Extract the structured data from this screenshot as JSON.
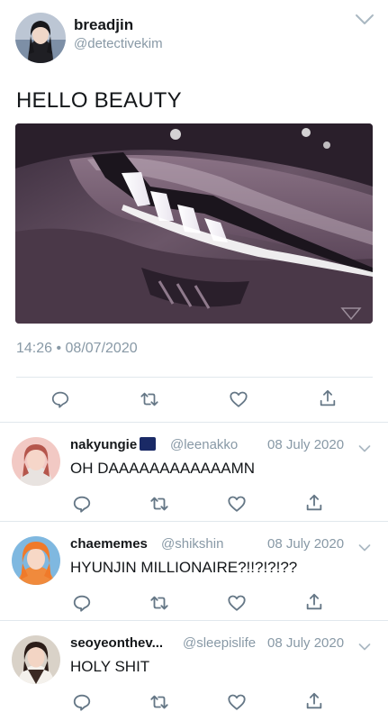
{
  "tweet": {
    "display_name": "breadjin",
    "handle": "@detectivekim",
    "text": "HELLO BEAUTY",
    "timestamp": "14:26 • 08/07/2020",
    "avatar_icon": "avatar-photo",
    "media_description_icon": "car-headlight-photo"
  },
  "actions": {
    "reply_icon": "reply-icon",
    "retweet_icon": "retweet-icon",
    "like_icon": "heart-icon",
    "share_icon": "share-icon"
  },
  "replies": [
    {
      "display_name": "nakyungie",
      "handle": "@leenakko",
      "date": "08 July 2020",
      "text": "OH DAAAAAAAAAAAAMN",
      "has_badge_emoji": true
    },
    {
      "display_name": "chaememes",
      "handle": "@shikshin",
      "date": "08 July 2020",
      "text": "HYUNJIN MILLIONAIRE?!!?!?!??",
      "has_badge_emoji": false
    },
    {
      "display_name": "seoyeonthev...",
      "handle": "@sleepislife",
      "date": "08 July 2020",
      "text": "HOLY SHIT",
      "has_badge_emoji": false
    }
  ],
  "colors": {
    "text": "#14171a",
    "secondary": "#8899a6",
    "icon": "#657786",
    "divider": "#e1e8ed"
  }
}
